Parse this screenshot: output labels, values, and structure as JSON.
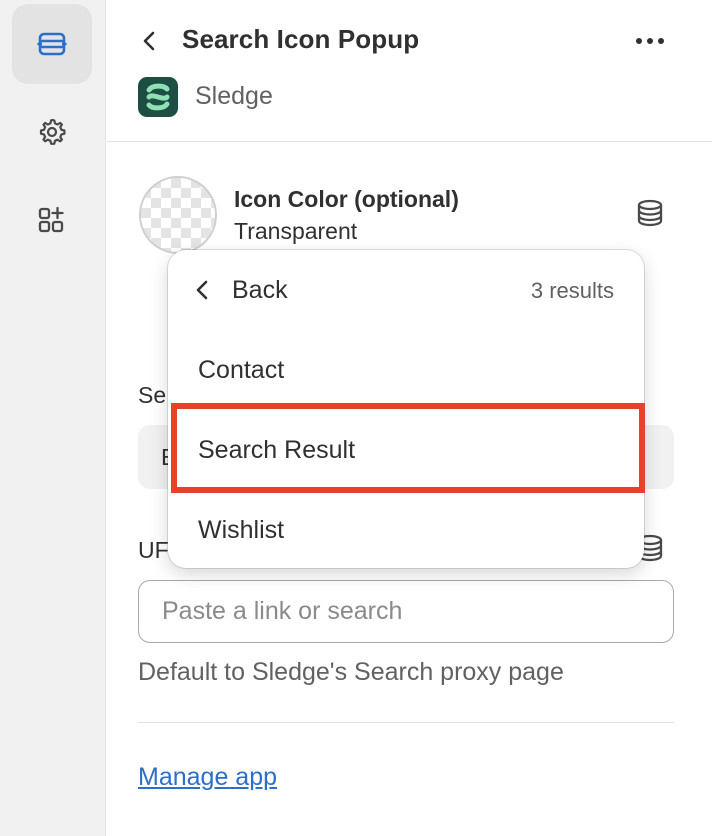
{
  "header": {
    "title": "Search Icon Popup",
    "app_name": "Sledge"
  },
  "color_setting": {
    "label": "Icon Color (optional)",
    "value": "Transparent"
  },
  "obscured": {
    "select_label_fragment": "Se",
    "select_value_fragment": "E",
    "url_label_fragment": "UF"
  },
  "url_field": {
    "placeholder": "Paste a link or search",
    "value": "",
    "helper": "Default to Sledge's Search proxy page"
  },
  "manage_link": "Manage app",
  "popover": {
    "back_label": "Back",
    "count": "3 results",
    "items": [
      {
        "label": "Contact"
      },
      {
        "label": "Search Result"
      },
      {
        "label": "Wishlist"
      }
    ]
  },
  "colors": {
    "accent": "#2c6ecb",
    "highlight": "#e8412c",
    "logo": "#1d4e43",
    "logo_mark": "#8fe0b5",
    "nav_active": "#2c6ecb"
  },
  "icons": {
    "rail": [
      "sections-icon",
      "gear-icon",
      "apps-add-icon"
    ],
    "header": [
      "chevron-left-icon",
      "more-horizontal-icon"
    ],
    "fields": [
      "database-icon"
    ]
  }
}
